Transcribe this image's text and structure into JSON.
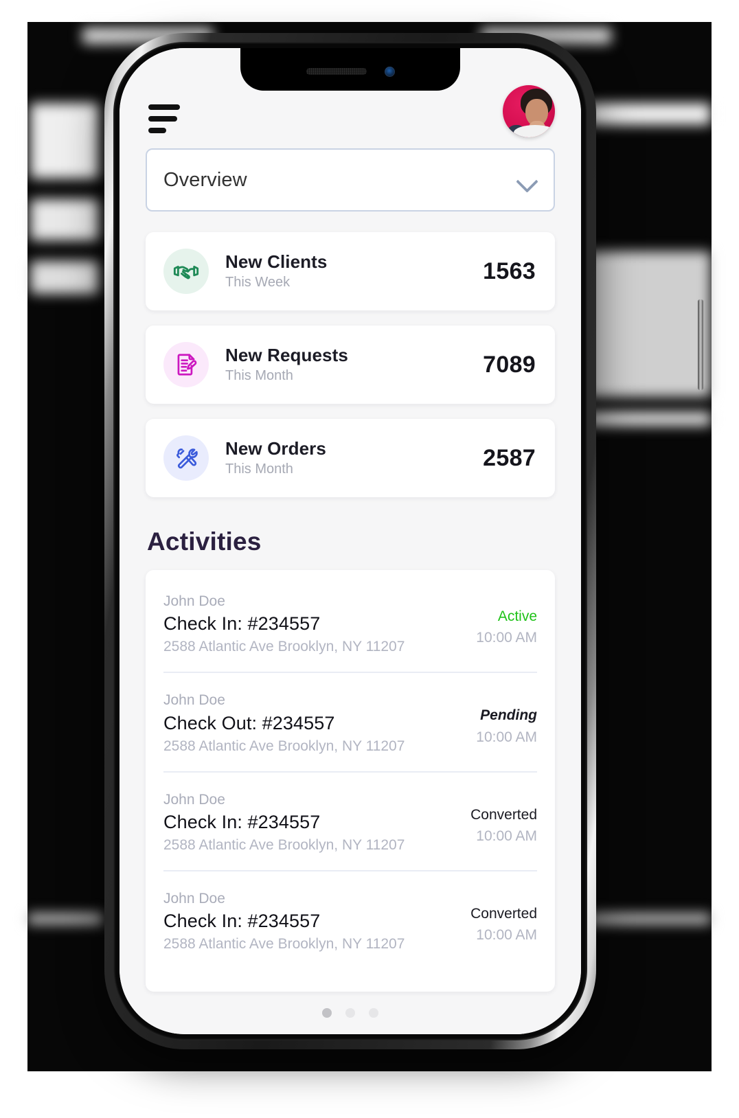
{
  "header": {
    "menu_icon": "hamburger-menu-icon",
    "avatar_alt": "user-avatar"
  },
  "filter": {
    "selected": "Overview",
    "chevron_icon": "chevron-down-icon"
  },
  "stats": [
    {
      "icon": "handshake-icon",
      "title": "New Clients",
      "period": "This Week",
      "value": "1563",
      "icon_color": "#1f8a57",
      "bubble_color": "#e6f3ec"
    },
    {
      "icon": "document-edit-icon",
      "title": "New Requests",
      "period": "This Month",
      "value": "7089",
      "icon_color": "#cc18c0",
      "bubble_color": "#fbe9fb"
    },
    {
      "icon": "tools-icon",
      "title": "New Orders",
      "period": "This Month",
      "value": "2587",
      "icon_color": "#3b5bdb",
      "bubble_color": "#e9ecfd"
    }
  ],
  "activities": {
    "heading": "Activities",
    "rows": [
      {
        "person": "John Doe",
        "title": "Check In: #234557",
        "address": "2588 Atlantic Ave Brooklyn, NY 11207",
        "status": "Active",
        "status_kind": "active",
        "time": "10:00 AM"
      },
      {
        "person": "John Doe",
        "title": "Check Out: #234557",
        "address": "2588 Atlantic Ave Brooklyn, NY 11207",
        "status": "Pending",
        "status_kind": "pending",
        "time": "10:00 AM"
      },
      {
        "person": "John Doe",
        "title": "Check In: #234557",
        "address": "2588 Atlantic Ave Brooklyn, NY 11207",
        "status": "Converted",
        "status_kind": "converted",
        "time": "10:00 AM"
      },
      {
        "person": "John Doe",
        "title": "Check In: #234557",
        "address": "2588 Atlantic Ave Brooklyn, NY 11207",
        "status": "Converted",
        "status_kind": "converted",
        "time": "10:00 AM"
      }
    ]
  },
  "pagination": {
    "total": 3,
    "active_index": 0
  },
  "colors": {
    "screen_bg": "#f6f6f7",
    "card_bg": "#ffffff",
    "heading": "#2b2040",
    "status_active": "#1fc218",
    "dropdown_border": "#c9d3e4"
  }
}
